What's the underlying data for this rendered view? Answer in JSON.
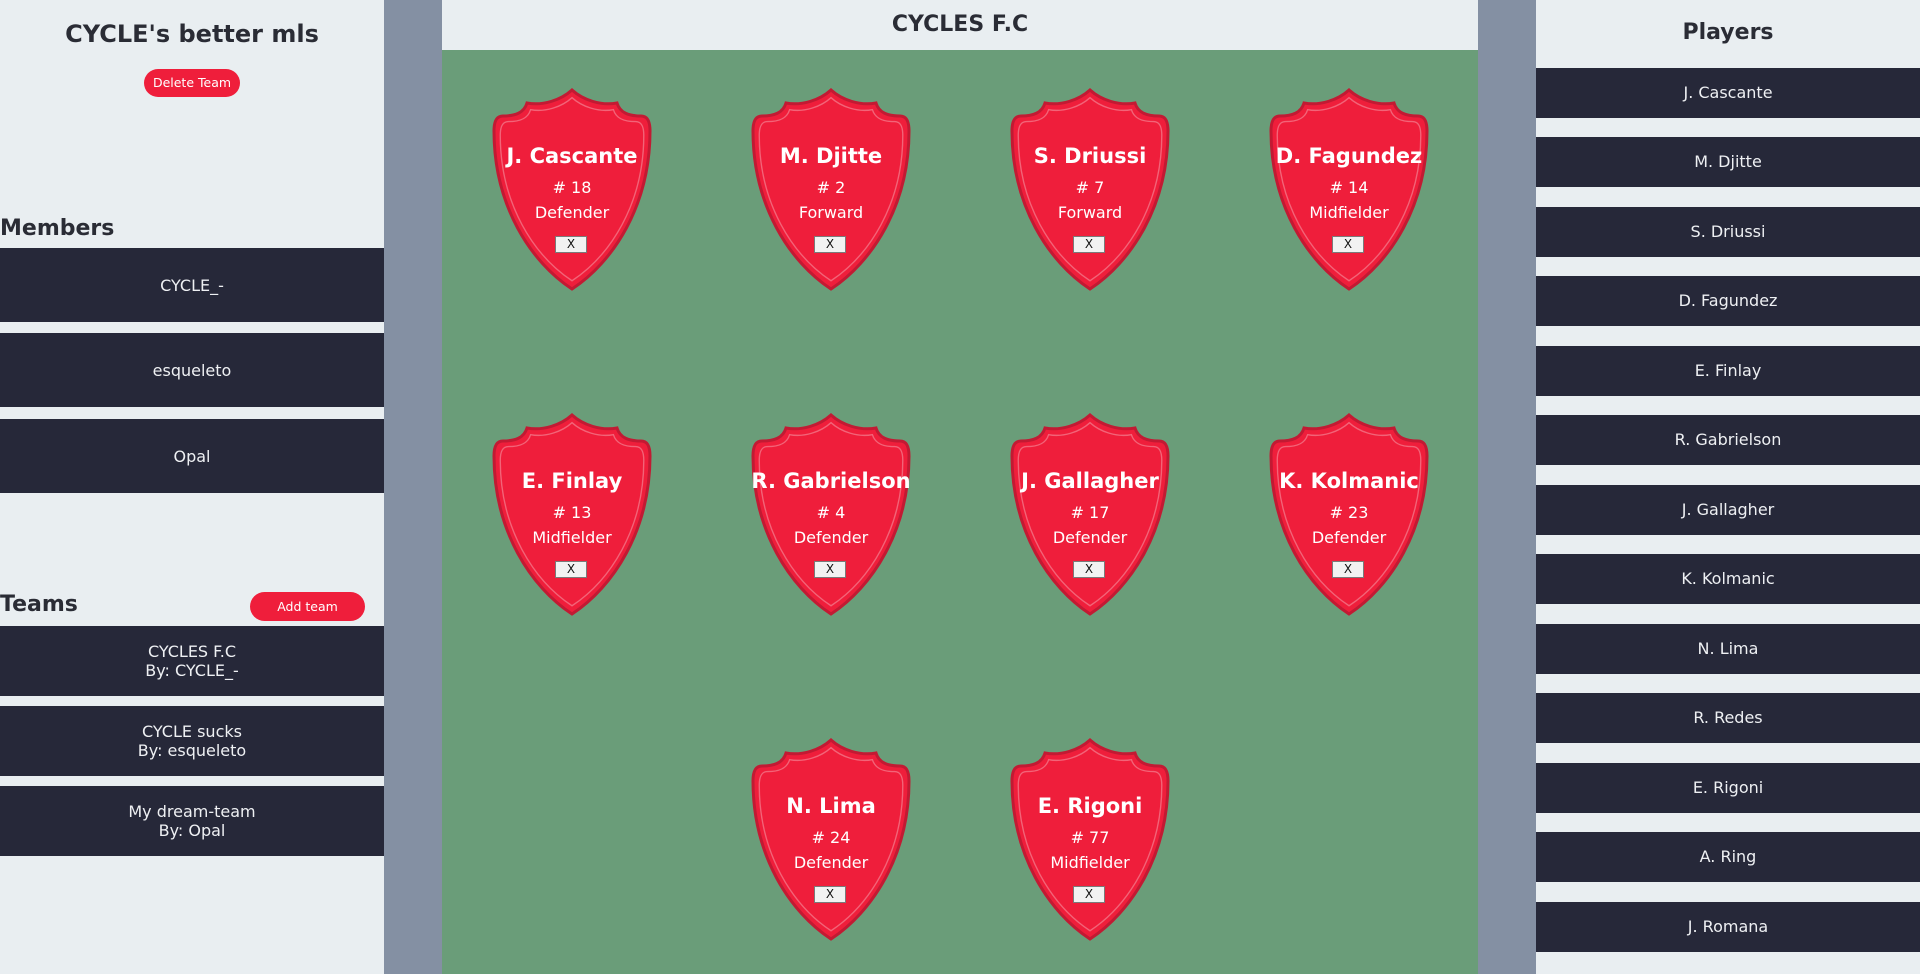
{
  "sidebar": {
    "app_title": "CYCLE's better mls",
    "delete_team_label": "Delete Team",
    "members_heading": "Members",
    "members": [
      "CYCLE_-",
      "esqueleto",
      "Opal"
    ],
    "teams_heading": "Teams",
    "add_team_label": "Add team",
    "teams": [
      {
        "name": "CYCLES F.C",
        "by": "By: CYCLE_-"
      },
      {
        "name": "CYCLE sucks",
        "by": "By: esqueleto"
      },
      {
        "name": "My dream-team",
        "by": "By: Opal"
      }
    ]
  },
  "team": {
    "title": "CYCLES F.C",
    "remove_label": "X",
    "cards": [
      {
        "name": "J. Cascante",
        "number": "# 18",
        "position": "Defender"
      },
      {
        "name": "M. Djitte",
        "number": "# 2",
        "position": "Forward"
      },
      {
        "name": "S. Driussi",
        "number": "# 7",
        "position": "Forward"
      },
      {
        "name": "D. Fagundez",
        "number": "# 14",
        "position": "Midfielder"
      },
      {
        "name": "E. Finlay",
        "number": "# 13",
        "position": "Midfielder"
      },
      {
        "name": "R. Gabrielson",
        "number": "# 4",
        "position": "Defender"
      },
      {
        "name": "J. Gallagher",
        "number": "# 17",
        "position": "Defender"
      },
      {
        "name": "K. Kolmanic",
        "number": "# 23",
        "position": "Defender"
      },
      {
        "name": "N. Lima",
        "number": "# 24",
        "position": "Defender"
      },
      {
        "name": "E. Rigoni",
        "number": "# 77",
        "position": "Midfielder"
      }
    ]
  },
  "players_panel": {
    "title": "Players",
    "players": [
      "J. Cascante",
      "M. Djitte",
      "S. Driussi",
      "D. Fagundez",
      "E. Finlay",
      "R. Gabrielson",
      "J. Gallagher",
      "K. Kolmanic",
      "N. Lima",
      "R. Redes",
      "E. Rigoni",
      "A. Ring",
      "J. Romana"
    ]
  },
  "colors": {
    "accent": "#ef1e3b",
    "dark_row": "#262839",
    "panel_bg": "#e9eef1",
    "pitch": "#6a9d79",
    "gutter": "#8490a3"
  }
}
